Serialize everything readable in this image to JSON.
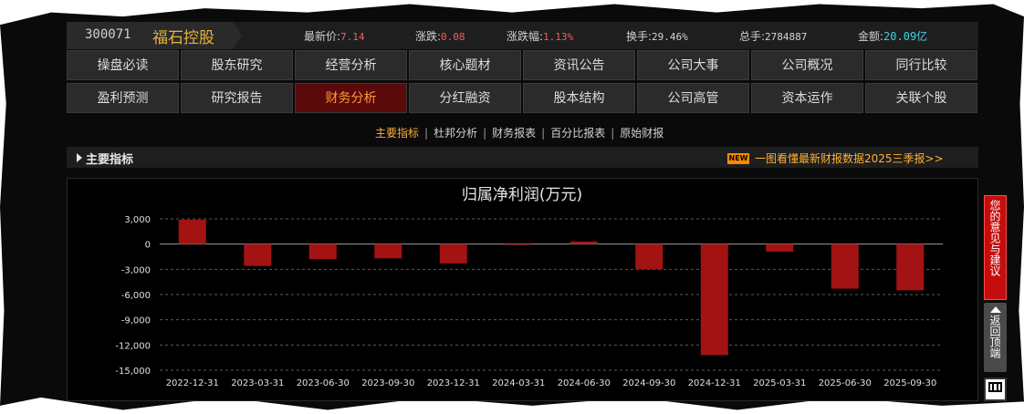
{
  "quote": {
    "code": "300071",
    "name": "福石控股",
    "latest_label": "最新价:",
    "latest_value": "7.14",
    "change_label": "涨跌:",
    "change_value": "0.08",
    "pct_label": "涨跌幅:",
    "pct_value": "1.13%",
    "turnover_label": "换手:",
    "turnover_value": "29.46%",
    "volume_label": "总手:",
    "volume_value": "2784887",
    "amount_label": "金额:",
    "amount_value": "20.09亿"
  },
  "nav": {
    "row1": [
      "操盘必读",
      "股东研究",
      "经营分析",
      "核心题材",
      "资讯公告",
      "公司大事",
      "公司概况",
      "同行比较"
    ],
    "row2": [
      "盈利预测",
      "研究报告",
      "财务分析",
      "分红融资",
      "股本结构",
      "公司高管",
      "资本运作",
      "关联个股"
    ],
    "active": "财务分析"
  },
  "subnav": {
    "items": [
      "主要指标",
      "杜邦分析",
      "财务报表",
      "百分比报表",
      "原始财报"
    ],
    "active": "主要指标",
    "separator": "|"
  },
  "section": {
    "title": "主要指标",
    "new_badge": "NEW",
    "promo": "一图看懂最新财报数据2025三季报>>"
  },
  "chart_data": {
    "type": "bar",
    "title": "归属净利润(万元)",
    "categories": [
      "2022-12-31",
      "2023-03-31",
      "2023-06-30",
      "2023-09-30",
      "2023-12-31",
      "2024-03-31",
      "2024-06-30",
      "2024-09-30",
      "2024-12-31",
      "2025-03-31",
      "2025-06-30",
      "2025-09-30"
    ],
    "values": [
      2900,
      -2600,
      -1800,
      -1700,
      -2300,
      -100,
      300,
      -3000,
      -13200,
      -900,
      -5300,
      -5500
    ],
    "yticks": [
      "3,000",
      "0",
      "-3,000",
      "-6,000",
      "-9,000",
      "-12,000",
      "-15,000"
    ],
    "ylim": [
      -15000,
      3000
    ],
    "grid": true,
    "bar_color": "#a31313"
  },
  "sidebar": {
    "feedback": "您的意见与建议",
    "backtop": "返回顶端"
  },
  "colors": {
    "accent": "#ffad3c",
    "up": "#ff5a5a",
    "amount": "#3fd3e6",
    "active_tab_bg": "#5a0a0a"
  }
}
